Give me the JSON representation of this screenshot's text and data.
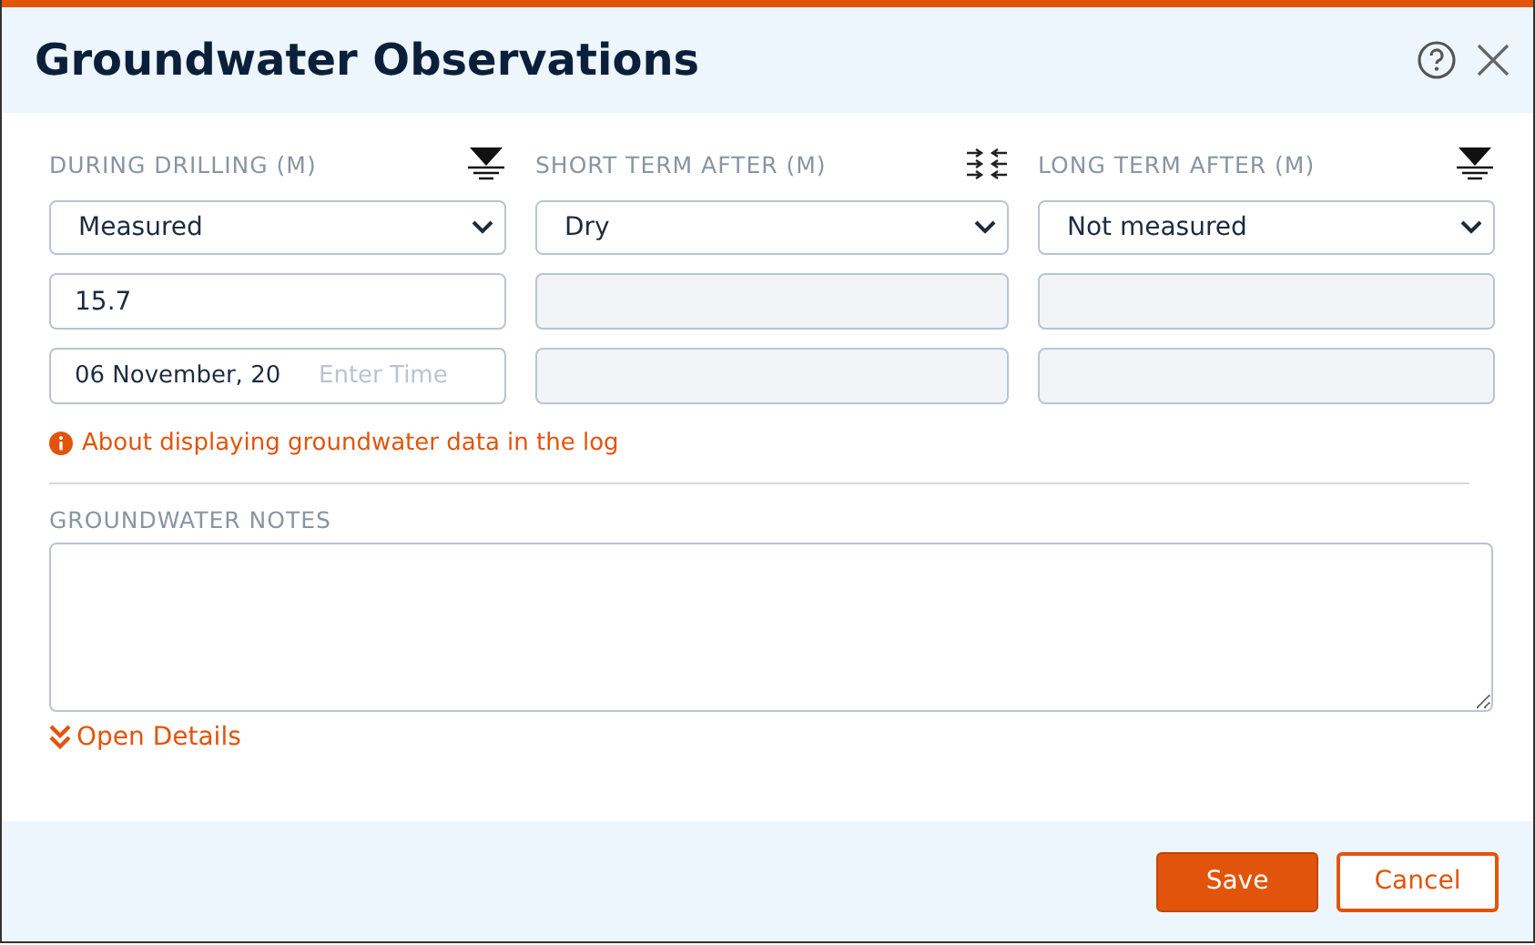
{
  "dialog": {
    "title": "Groundwater Observations"
  },
  "columns": [
    {
      "label": "DURING DRILLING (M)",
      "kind": "water-level",
      "status": "Measured",
      "disabled": false,
      "depth": "15.7",
      "date": "06 November, 20",
      "time_placeholder": "Enter Time"
    },
    {
      "label": "SHORT TERM AFTER (M)",
      "kind": "flow",
      "status": "Dry",
      "disabled": true
    },
    {
      "label": "LONG TERM AFTER (M)",
      "kind": "water-level",
      "status": "Not measured",
      "disabled": true
    }
  ],
  "info_link": "About displaying groundwater data in the log",
  "notes": {
    "label": "GROUNDWATER NOTES"
  },
  "details_link": "Open Details",
  "buttons": [
    {
      "label": "Save",
      "kind": "primary"
    },
    {
      "label": "Cancel",
      "kind": "secondary"
    }
  ]
}
